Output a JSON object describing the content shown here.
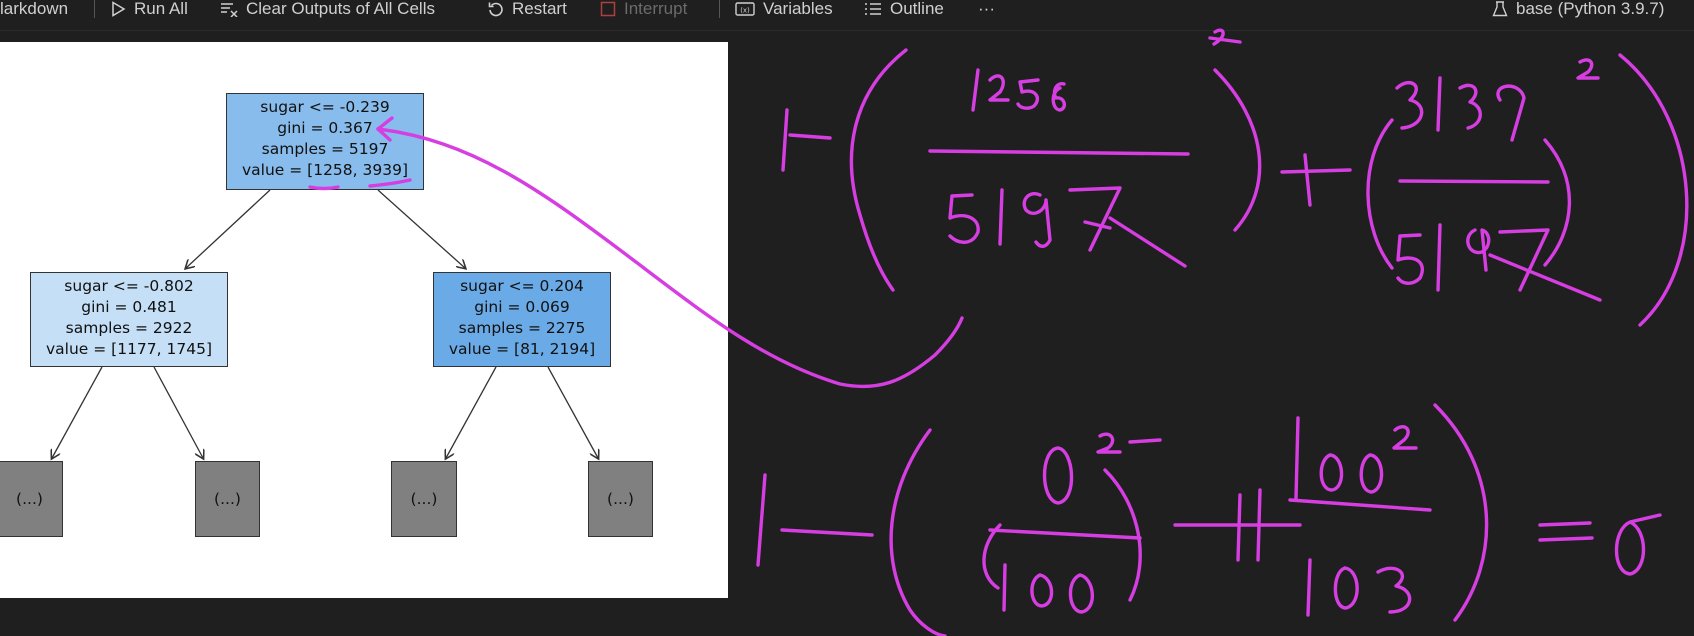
{
  "toolbar": {
    "markdown": "larkdown",
    "run_all": "Run All",
    "clear_outputs": "Clear Outputs of All Cells",
    "restart": "Restart",
    "interrupt": "Interrupt",
    "variables": "Variables",
    "outline": "Outline",
    "more": "···",
    "kernel": "base (Python 3.9.7)"
  },
  "tree": {
    "root": {
      "line1": "sugar <= -0.239",
      "line2": "gini = 0.367",
      "line3": "samples = 5197",
      "line4": "value = [1258, 3939]",
      "color": "#88bcec"
    },
    "left": {
      "line1": "sugar <= -0.802",
      "line2": "gini = 0.481",
      "line3": "samples = 2922",
      "line4": "value = [1177, 1745]",
      "color": "#c4dff6"
    },
    "right": {
      "line1": "sugar <= 0.204",
      "line2": "gini = 0.069",
      "line3": "samples = 2275",
      "line4": "value = [81, 2194]",
      "color": "#6aaae6"
    },
    "leaves": [
      "(...)",
      "(...)",
      "(...)",
      "(...)"
    ]
  },
  "annotation": {
    "color": "#d63ee2",
    "note": "Handwritten Gini impurity calculation: 1-((1258/5197)^2+(3939/5197)^2) and 1-((0/100)^2+(100/103)^2)=0"
  }
}
